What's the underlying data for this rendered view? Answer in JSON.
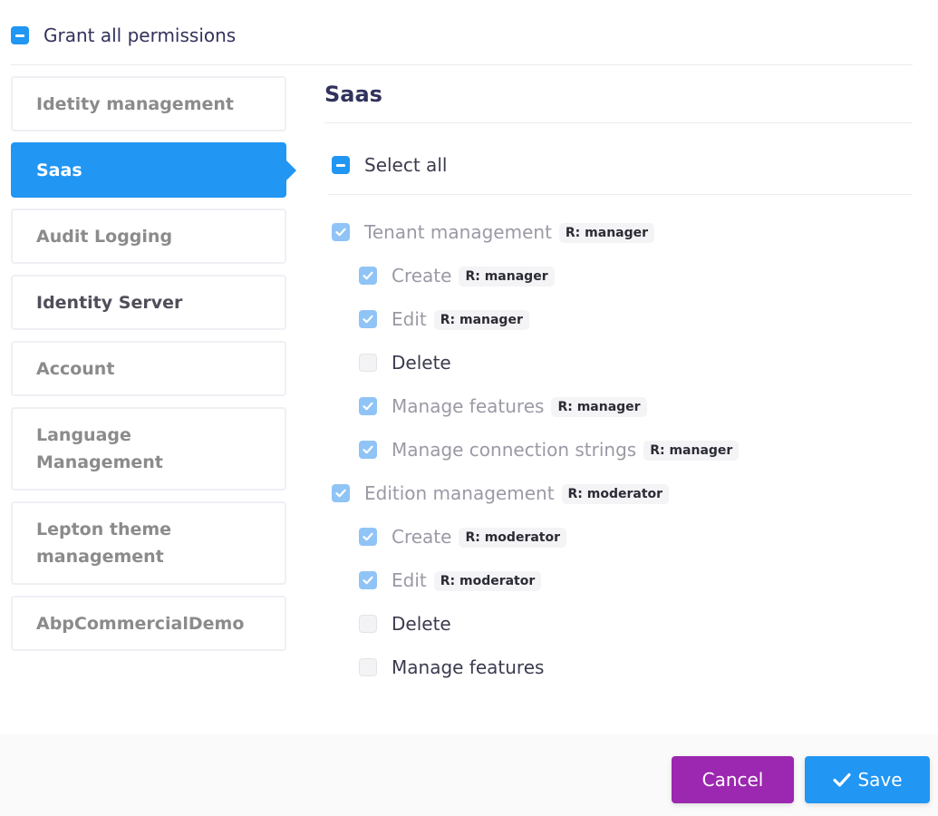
{
  "grant_all": {
    "label": "Grant all permissions",
    "state": "indeterminate"
  },
  "nav": {
    "items": [
      {
        "label": "Idetity management",
        "active": false
      },
      {
        "label": "Saas",
        "active": true
      },
      {
        "label": "Audit Logging",
        "active": false
      },
      {
        "label": "Identity Server",
        "active": false
      },
      {
        "label": "Account",
        "active": false
      },
      {
        "label": "Language Management",
        "active": false
      },
      {
        "label": "Lepton theme management",
        "active": false
      },
      {
        "label": "AbpCommercialDemo",
        "active": false
      }
    ]
  },
  "panel": {
    "title": "Saas",
    "select_all": {
      "label": "Select all",
      "state": "indeterminate"
    },
    "permissions": [
      {
        "label": "Tenant management",
        "badge": "R: manager",
        "state": "checked",
        "level": 0
      },
      {
        "label": "Create",
        "badge": "R: manager",
        "state": "checked",
        "level": 1
      },
      {
        "label": "Edit",
        "badge": "R: manager",
        "state": "checked",
        "level": 1
      },
      {
        "label": "Delete",
        "badge": "",
        "state": "unchecked",
        "level": 1
      },
      {
        "label": "Manage features",
        "badge": "R: manager",
        "state": "checked",
        "level": 1
      },
      {
        "label": "Manage connection strings",
        "badge": "R: manager",
        "state": "checked",
        "level": 1
      },
      {
        "label": "Edition management",
        "badge": "R: moderator",
        "state": "checked",
        "level": 0
      },
      {
        "label": "Create",
        "badge": "R: moderator",
        "state": "checked",
        "level": 1
      },
      {
        "label": "Edit",
        "badge": "R: moderator",
        "state": "checked",
        "level": 1
      },
      {
        "label": "Delete",
        "badge": "",
        "state": "unchecked",
        "level": 1
      },
      {
        "label": "Manage features",
        "badge": "",
        "state": "unchecked",
        "level": 1
      }
    ]
  },
  "footer": {
    "cancel_label": "Cancel",
    "save_label": "Save"
  },
  "colors": {
    "primary": "#2196f3",
    "cancel": "#9c27b0",
    "checked_muted": "#90c4f6"
  },
  "icons": {
    "save": "check-icon",
    "checkbox_indeterminate": "minus-icon",
    "checkbox_checked": "check-icon"
  }
}
